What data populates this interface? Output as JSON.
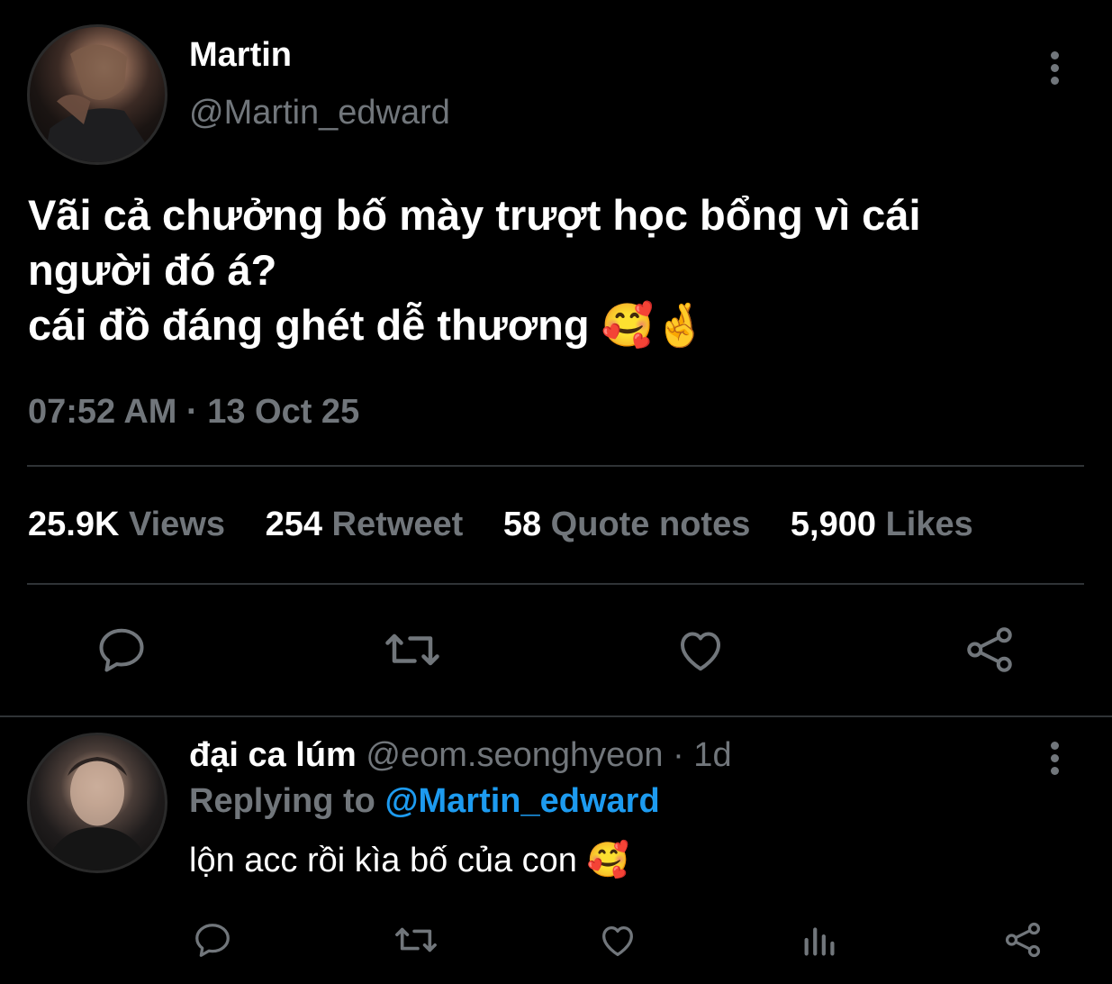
{
  "tweet": {
    "author_name": "Martin",
    "author_handle": "@Martin_edward",
    "text_line1": "Vãi cả chưởng bố mày trượt học bổng vì cái",
    "text_line2": "người đó á?",
    "text_line3": "cái đồ đáng ghét dễ thương",
    "text_line3_emoji": "🥰🤞",
    "timestamp": "07:52 AM · 13 Oct 25",
    "stats": [
      {
        "count": "25.9K",
        "label": "Views"
      },
      {
        "count": "254",
        "label": "Retweet"
      },
      {
        "count": "58",
        "label": "Quote notes"
      },
      {
        "count": "5,900",
        "label": "Likes"
      }
    ],
    "actions": [
      "reply-icon",
      "retweet-icon",
      "like-icon",
      "share-icon"
    ]
  },
  "reply": {
    "author_name": "đại ca lúm",
    "author_handle": "@eom.seonghyeon",
    "time": "· 1d",
    "replying_label": "Replying to",
    "replying_handle": "@Martin_edward",
    "text": "lộn acc rồi kìa bố của con",
    "text_emoji": "🥰",
    "actions": [
      "reply-icon",
      "retweet-icon",
      "like-icon",
      "views-icon",
      "share-icon"
    ]
  },
  "colors": {
    "background": "#000000",
    "text_primary": "#ffffff",
    "text_secondary": "#71767b",
    "link": "#1d9bf0",
    "divider": "#2f3336"
  }
}
